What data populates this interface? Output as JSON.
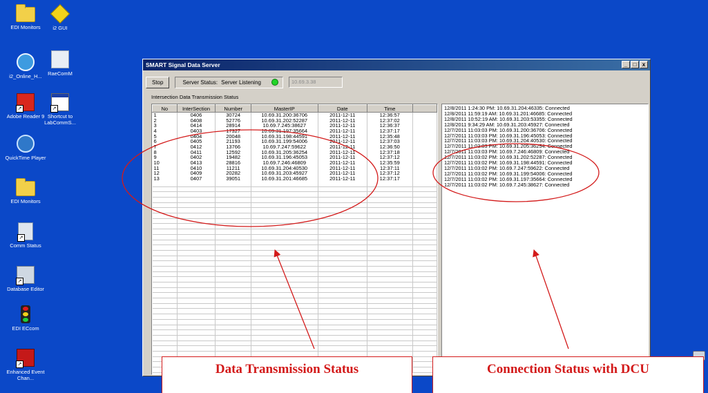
{
  "desktop": {
    "icons": [
      {
        "label": "EDI Monitors",
        "icon": "folder-icon"
      },
      {
        "label": "i2 GUI",
        "icon": "diamond-sign-icon"
      },
      {
        "label": "i2_Online_H...",
        "icon": "internet-explorer-icon"
      },
      {
        "label": "RaeComM",
        "icon": "reno-app-icon"
      },
      {
        "label": "Adobe Reader 9",
        "icon": "adobe-reader-icon"
      },
      {
        "label": "Shortcut to LabCommS...",
        "icon": "window-app-icon"
      },
      {
        "label": "QuickTime Player",
        "icon": "quicktime-icon"
      },
      {
        "label": "EDI Monitors",
        "icon": "folder-icon"
      },
      {
        "label": "Comm Status",
        "icon": "network-icon"
      },
      {
        "label": "Database Editor",
        "icon": "database-icon"
      },
      {
        "label": "EDI ECcom",
        "icon": "traffic-light-icon"
      },
      {
        "label": "Enhanced Event Chan...",
        "icon": "event-icon"
      }
    ]
  },
  "window": {
    "title": "SMART Signal Data Server",
    "controls": {
      "minimize": "_",
      "maximize": "□",
      "close": "x"
    }
  },
  "toolbar": {
    "stop_label": "Stop",
    "status_label": "Server Status:",
    "status_value": "Server Listening",
    "status_color": "#22d428",
    "ip_value": "10.69.3.38"
  },
  "section_label": "Intersection Data Transmission Status",
  "table": {
    "columns": [
      "No",
      "InterSection",
      "Number",
      "MasterIP",
      "Date",
      "Time"
    ],
    "rows": [
      [
        "1",
        "0406",
        "30724",
        "10.69.31.200:36706",
        "2011-12-11",
        "12:36:57"
      ],
      [
        "2",
        "0408",
        "52776",
        "10.69.31.202:52287",
        "2011-12-11",
        "12:37:02"
      ],
      [
        "3",
        "0414",
        "28914",
        "10.69.7.245:38627",
        "2011-12-11",
        "12:36:37"
      ],
      [
        "4",
        "0403",
        "17327",
        "10.69.31.197:35664",
        "2011-12-11",
        "12:37:17"
      ],
      [
        "5",
        "0404",
        "20048",
        "10.69.31.198:44591",
        "2011-12-11",
        "12:35:48"
      ],
      [
        "6",
        "0405",
        "21193",
        "10.69.31.199:54006",
        "2011-12-11",
        "12:37:03"
      ],
      [
        "7",
        "0412",
        "13766",
        "10.69.7.247:59622",
        "2011-12-11",
        "12:36:50"
      ],
      [
        "8",
        "0411",
        "12592",
        "10.69.31.205:36254",
        "2011-12-11",
        "12:37:18"
      ],
      [
        "9",
        "0402",
        "19482",
        "10.69.31.196:45053",
        "2011-12-11",
        "12:37:12"
      ],
      [
        "10",
        "0413",
        "28816",
        "10.69.7.246:46809",
        "2011-12-11",
        "12:35:59"
      ],
      [
        "11",
        "0410",
        "11211",
        "10.69.31.204:40530",
        "2011-12-11",
        "12:37:11"
      ],
      [
        "12",
        "0409",
        "20282",
        "10.69.31.203:45927",
        "2011-12-11",
        "12:37:12"
      ],
      [
        "13",
        "0407",
        "39051",
        "10.69.31.201:46685",
        "2011-12-11",
        "12:37:17"
      ]
    ],
    "empty_rows": 36
  },
  "log": [
    "12/8/2011 1:24:30 PM:  10.69.31.204:46335: Connected",
    "12/8/2011 11:59:19 AM:  10.69.31.201:46685: Connected",
    "12/8/2011 10:52:19 AM:  10.69.31.203:53355: Connected",
    "12/8/2011 9:34:29 AM:  10.69.31.203:45927: Connected",
    "12/7/2011 11:03:03 PM:  10.69.31.200:36706: Connected",
    "12/7/2011 11:03:03 PM:  10.69.31.196:45053: Connected",
    "12/7/2011 11:03:03 PM:  10.69.31.204:40530: Connected",
    "12/7/2011 11:03:03 PM:  10.69.31.205:36254: Connected",
    "12/7/2011 11:03:03 PM:  10.69.7.246:46809: Connected",
    "12/7/2011 11:03:02 PM:  10.69.31.202:52287: Connected",
    "12/7/2011 11:03:02 PM:  10.69.31.198:44591: Connected",
    "12/7/2011 11:03:02 PM:  10.69.7.247:59622: Connected",
    "12/7/2011 11:03:02 PM:  10.69.31.199:54006: Connected",
    "12/7/2011 11:03:02 PM:  10.69.31.197:35664: Connected",
    "12/7/2011 11:03:02 PM:  10.69.7.245:38627: Connected"
  ],
  "annotations": {
    "left_callout": "Data Transmission Status",
    "right_callout": "Connection Status with DCU",
    "color": "#d31a1a"
  }
}
